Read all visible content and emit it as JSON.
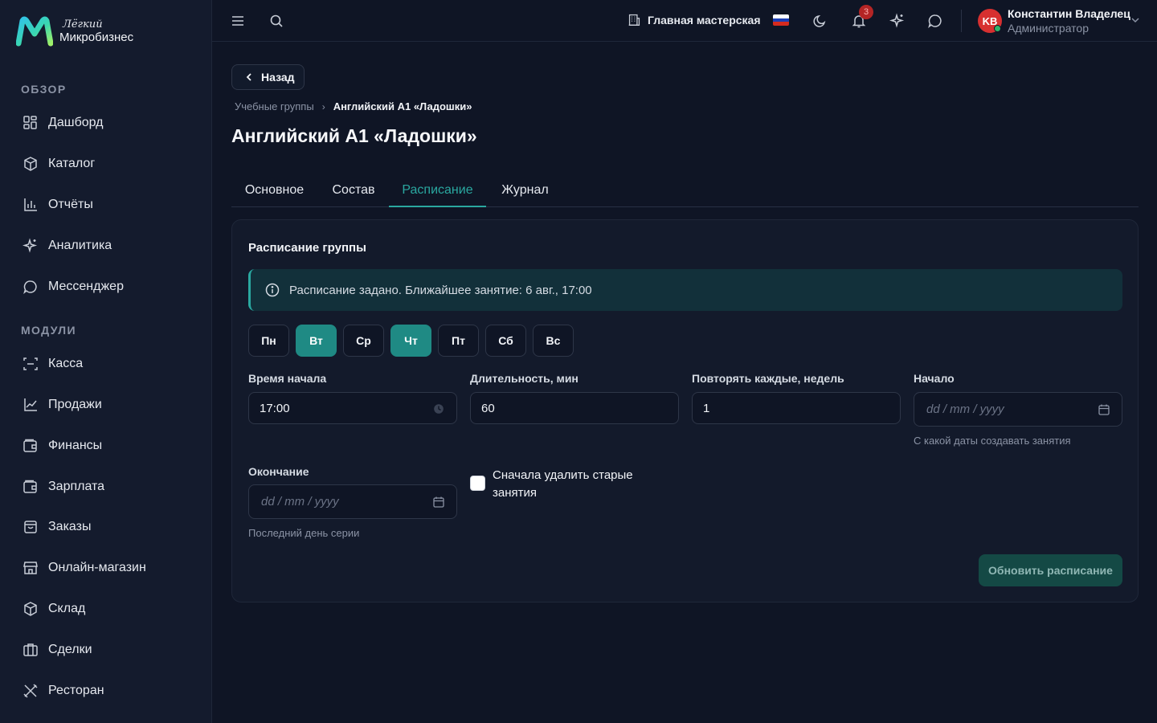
{
  "app": {
    "logo_small": "Лёгкий",
    "logo_big": "Микробизнес"
  },
  "sidebar": {
    "sections": [
      {
        "title": "ОБЗОР"
      },
      {
        "title": "МОДУЛИ"
      }
    ],
    "items": [
      {
        "label": "Дашборд",
        "icon": "dashboard-icon"
      },
      {
        "label": "Каталог",
        "icon": "catalog-icon"
      },
      {
        "label": "Отчёты",
        "icon": "reports-icon"
      },
      {
        "label": "Аналитика",
        "icon": "sparkle-icon"
      },
      {
        "label": "Мессенджер",
        "icon": "chat-icon"
      },
      {
        "label": "Касса",
        "icon": "scan-icon"
      },
      {
        "label": "Продажи",
        "icon": "chart-line-icon"
      },
      {
        "label": "Финансы",
        "icon": "wallet-icon"
      },
      {
        "label": "Зарплата",
        "icon": "wallet-icon"
      },
      {
        "label": "Заказы",
        "icon": "shopping-bag-icon"
      },
      {
        "label": "Онлайн-магазин",
        "icon": "store-icon"
      },
      {
        "label": "Склад",
        "icon": "box-icon"
      },
      {
        "label": "Сделки",
        "icon": "briefcase-icon"
      },
      {
        "label": "Ресторан",
        "icon": "utensils-icon"
      }
    ]
  },
  "topbar": {
    "workshop": "Главная мастерская",
    "notifications_count": "3",
    "user_initials": "KB",
    "user_name": "Константин Владелец",
    "user_role": "Администратор"
  },
  "main": {
    "back_label": "Назад",
    "breadcrumb": {
      "parent": "Учебные группы",
      "current": "Английский A1 «Ладошки»"
    },
    "title": "Английский A1 «Ладошки»",
    "tabs": [
      {
        "label": "Основное",
        "active": false
      },
      {
        "label": "Состав",
        "active": false
      },
      {
        "label": "Расписание",
        "active": true
      },
      {
        "label": "Журнал",
        "active": false
      }
    ],
    "schedule": {
      "title": "Расписание группы",
      "alert": "Расписание задано. Ближайшее занятие: 6 авг., 17:00",
      "days": [
        {
          "label": "Пн",
          "selected": false
        },
        {
          "label": "Вт",
          "selected": true
        },
        {
          "label": "Ср",
          "selected": false
        },
        {
          "label": "Чт",
          "selected": true
        },
        {
          "label": "Пт",
          "selected": false
        },
        {
          "label": "Сб",
          "selected": false
        },
        {
          "label": "Вс",
          "selected": false
        }
      ],
      "start_time": {
        "label": "Время начала",
        "value": "17:00"
      },
      "duration": {
        "label": "Длительность, мин",
        "value": "60"
      },
      "repeat": {
        "label": "Повторять каждые, недель",
        "value": "1"
      },
      "start_date": {
        "label": "Начало",
        "placeholder": "dd / mm / yyyy",
        "hint": "С какой даты создавать занятия"
      },
      "end_date": {
        "label": "Окончание",
        "placeholder": "dd / mm / yyyy",
        "hint": "Последний день серии"
      },
      "delete_old": {
        "label": "Сначала удалить старые занятия",
        "checked": false
      },
      "submit_label": "Обновить расписание"
    }
  },
  "colors": {
    "accent": "#2aa8a0",
    "background": "#0f1525",
    "sidebar": "#141b2d",
    "badge": "#b42525"
  }
}
